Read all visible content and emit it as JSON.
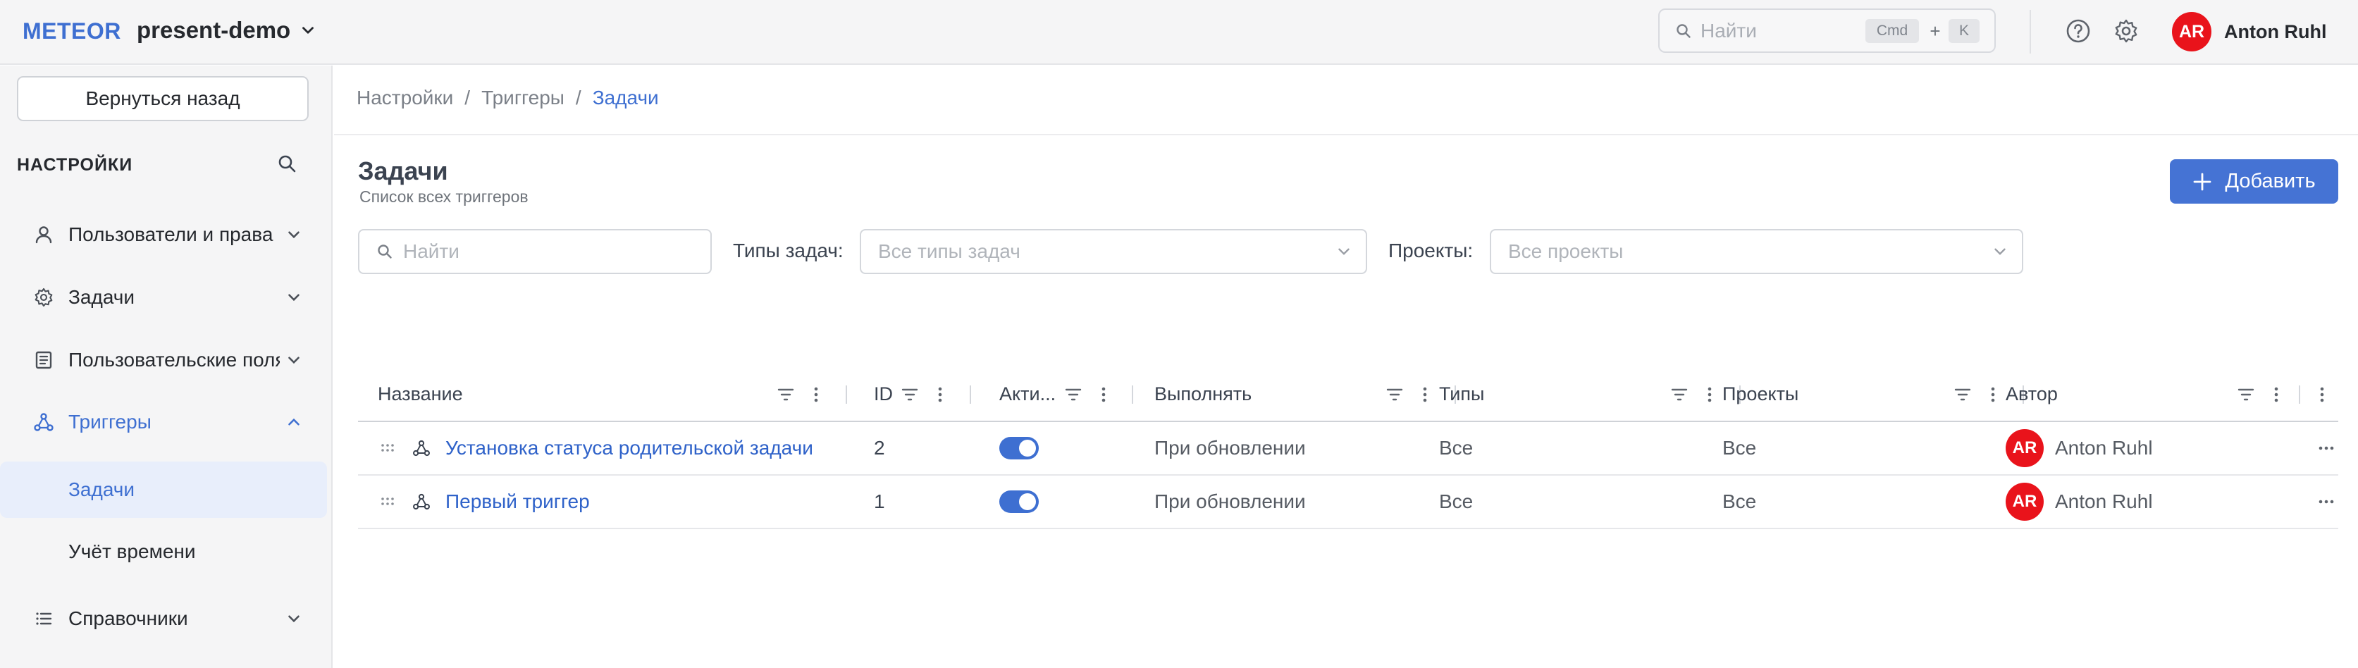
{
  "header": {
    "logo": "METEOR",
    "project": "present-demo",
    "search_placeholder": "Найти",
    "shortcut_cmd": "Cmd",
    "shortcut_plus": "+",
    "shortcut_k": "K",
    "user_initials": "AR",
    "user_name": "Anton Ruhl",
    "avatar_color": "#e9131b",
    "accent_color": "#3e6fd1"
  },
  "sidebar": {
    "back_label": "Вернуться назад",
    "section_title": "НАСТРОЙКИ",
    "items": [
      {
        "label": "Пользователи и права",
        "icon": "user-icon",
        "expanded": false
      },
      {
        "label": "Задачи",
        "icon": "gear-icon",
        "expanded": false
      },
      {
        "label": "Пользовательские поля",
        "icon": "list-box-icon",
        "expanded": false
      },
      {
        "label": "Триггеры",
        "icon": "trigger-icon",
        "expanded": true
      },
      {
        "label": "Справочники",
        "icon": "list-icon",
        "expanded": false
      }
    ],
    "subitems": [
      {
        "label": "Задачи",
        "selected": true
      },
      {
        "label": "Учёт времени",
        "selected": false
      }
    ]
  },
  "breadcrumb": {
    "items": [
      "Настройки",
      "Триггеры",
      "Задачи"
    ],
    "separator": "/"
  },
  "page": {
    "title": "Задачи",
    "subtitle": "Список всех триггеров",
    "add_label": "Добавить"
  },
  "filters": {
    "search_placeholder": "Найти",
    "task_types_label": "Типы задач",
    "task_types_placeholder": "Все типы задач",
    "projects_label": "Проекты",
    "projects_placeholder": "Все проекты",
    "colon": ":"
  },
  "table": {
    "columns": [
      "Название",
      "ID",
      "Акти...",
      "Выполнять",
      "Типы",
      "Проекты",
      "Автор"
    ],
    "rows": [
      {
        "name": "Установка статуса родительской задачи",
        "id": "2",
        "active": true,
        "run": "При обновлении",
        "types": "Все",
        "projects": "Все",
        "author_initials": "AR",
        "author": "Anton Ruhl"
      },
      {
        "name": "Первый триггер",
        "id": "1",
        "active": true,
        "run": "При обновлении",
        "types": "Все",
        "projects": "Все",
        "author_initials": "AR",
        "author": "Anton Ruhl"
      }
    ]
  }
}
